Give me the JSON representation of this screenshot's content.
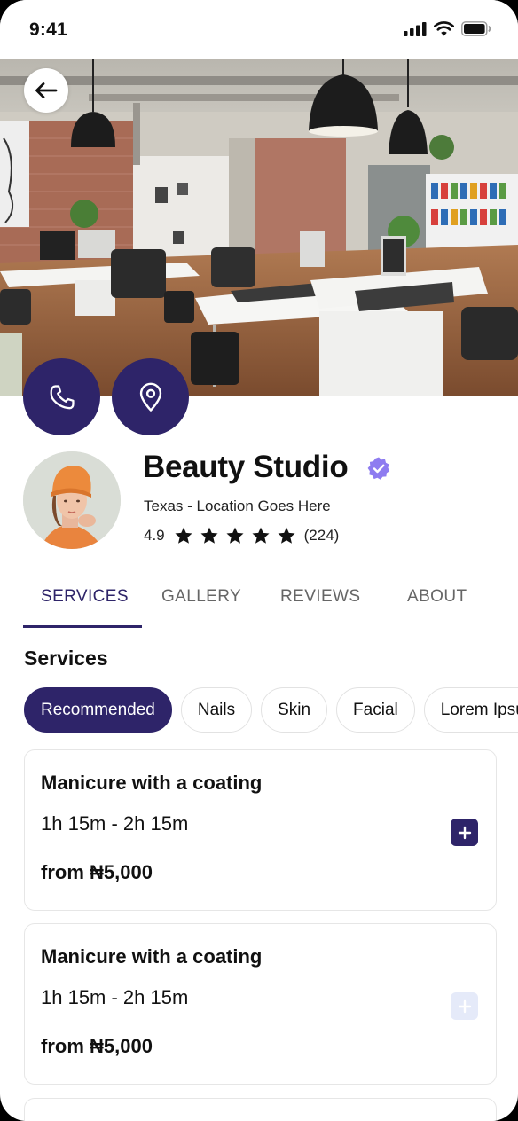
{
  "status_bar": {
    "time": "9:41"
  },
  "business": {
    "name": "Beauty Studio",
    "location": "Texas - Location Goes Here",
    "rating": "4.9",
    "stars": 5,
    "review_count": "(224)"
  },
  "tabs": [
    {
      "label": "SERVICES",
      "active": true
    },
    {
      "label": "GALLERY",
      "active": false
    },
    {
      "label": "REVIEWS",
      "active": false
    },
    {
      "label": "ABOUT",
      "active": false
    }
  ],
  "services": {
    "title": "Services",
    "chips": [
      {
        "label": "Recommended",
        "active": true
      },
      {
        "label": "Nails",
        "active": false
      },
      {
        "label": "Skin",
        "active": false
      },
      {
        "label": "Facial",
        "active": false
      },
      {
        "label": "Lorem Ipsum",
        "active": false
      }
    ],
    "items": [
      {
        "title": "Manicure with a coating",
        "duration": "1h 15m - 2h 15m",
        "price": "from ₦5,000",
        "add_enabled": true
      },
      {
        "title": "Manicure with a coating",
        "duration": "1h 15m - 2h 15m",
        "price": "from ₦5,000",
        "add_enabled": false
      }
    ]
  },
  "icons": {
    "back": "arrow-left-icon",
    "call": "phone-icon",
    "location": "map-pin-icon",
    "verified": "verified-badge-icon",
    "star": "star-icon",
    "add": "plus-icon"
  },
  "colors": {
    "primary": "#2e2469",
    "verified": "#8e7cf0",
    "disabled_button": "#e5eaf9"
  }
}
